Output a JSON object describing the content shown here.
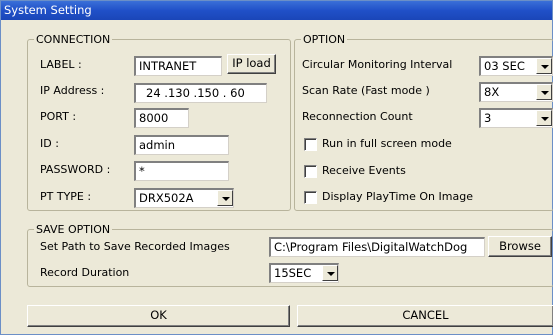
{
  "window": {
    "title": "System Setting"
  },
  "connection": {
    "title": "CONNECTION",
    "label_label": "LABEL :",
    "label_value": "INTRANET",
    "ip_load_button": "IP load",
    "ip_label": "IP Address :",
    "ip_value": "24 .130 .150 . 60",
    "port_label": "PORT :",
    "port_value": "8000",
    "id_label": "ID :",
    "id_value": "admin",
    "password_label": "PASSWORD :",
    "password_value": "*",
    "pt_type_label": "PT TYPE :",
    "pt_type_value": "DRX502A"
  },
  "option": {
    "title": "OPTION",
    "monitoring_label": "Circular Monitoring Interval",
    "monitoring_value": "03 SEC",
    "scan_rate_label": "Scan Rate (Fast mode )",
    "scan_rate_value": "8X",
    "reconnection_label": "Reconnection Count",
    "reconnection_value": "3",
    "fullscreen_label": "Run in full screen mode",
    "fullscreen_checked": false,
    "receive_events_label": "Receive Events",
    "receive_events_checked": false,
    "playtime_label": "Display PlayTime On Image",
    "playtime_checked": false
  },
  "save_option": {
    "title": "SAVE OPTION",
    "path_label": "Set Path to Save Recorded  Images",
    "path_value": "C:\\Program Files\\DigitalWatchDog",
    "browse_button": "Browse",
    "duration_label": "Record Duration",
    "duration_value": "15SEC"
  },
  "footer": {
    "ok_button": "OK",
    "cancel_button": "CANCEL"
  }
}
